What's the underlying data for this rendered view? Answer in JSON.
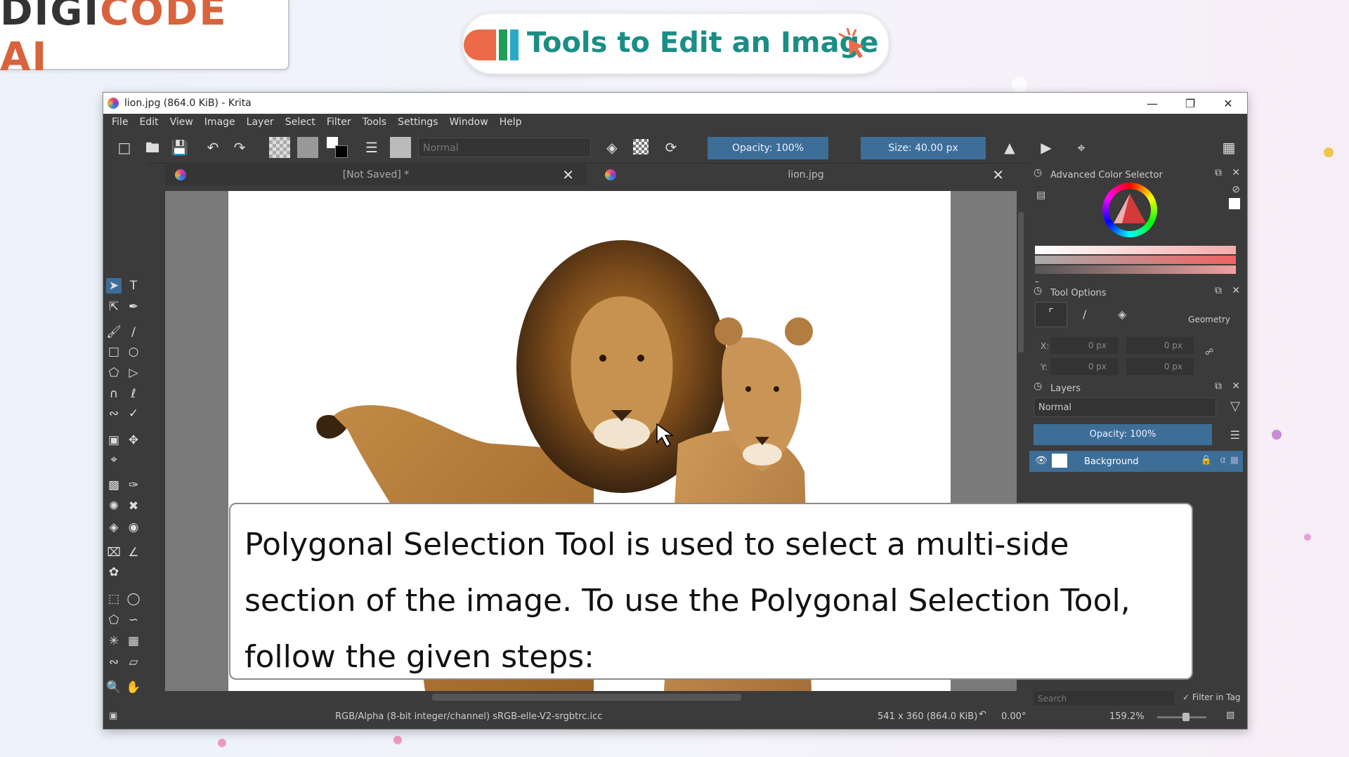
{
  "branding": {
    "logo_part1": "DIGI",
    "logo_part2": "CODE AI",
    "title": "Tools to Edit an Image"
  },
  "window": {
    "title": "lion.jpg (864.0 KiB)  - Krita",
    "controls": {
      "minimize": "—",
      "restore": "❐",
      "close": "✕"
    }
  },
  "menu": [
    "File",
    "Edit",
    "View",
    "Image",
    "Layer",
    "Select",
    "Filter",
    "Tools",
    "Settings",
    "Window",
    "Help"
  ],
  "toolbar": {
    "blend_mode": "Normal",
    "opacity": "Opacity: 100%",
    "size": "Size: 40.00 px"
  },
  "tabs": [
    {
      "label": "[Not Saved]  *",
      "close": "✕"
    },
    {
      "label": "lion.jpg",
      "close": "✕"
    }
  ],
  "dockers": {
    "color_selector": {
      "title": "Advanced Color Selector"
    },
    "tool_options": {
      "title": "Tool Options",
      "geometry_label": "Geometry",
      "x_label": "X:",
      "y_label": "Y:",
      "x_value": "0 px",
      "x2_value": "0 px",
      "y_value": "0 px",
      "y2_value": "0 px"
    },
    "layers": {
      "title": "Layers",
      "blend_mode": "Normal",
      "opacity": "Opacity:  100%",
      "layer_name": "Background"
    },
    "resources": {
      "search_placeholder": "Search",
      "filter_in_tag": "Filter in Tag"
    }
  },
  "status": {
    "color_space": "RGB/Alpha (8-bit integer/channel)  sRGB-elle-V2-srgbtrc.icc",
    "dimensions": "541 x 360 (864.0 KiB)",
    "rotation": "0.00°",
    "zoom": "159.2%"
  },
  "caption": "Polygonal Selection Tool is used to select a multi-side section of the image. To use the Polygonal Selection Tool, follow the given steps:",
  "colors": {
    "accent": "#3c6e98",
    "ui_bg": "#3b3b3b",
    "title_teal": "#1a8e85",
    "logo_orange": "#d8633d"
  }
}
